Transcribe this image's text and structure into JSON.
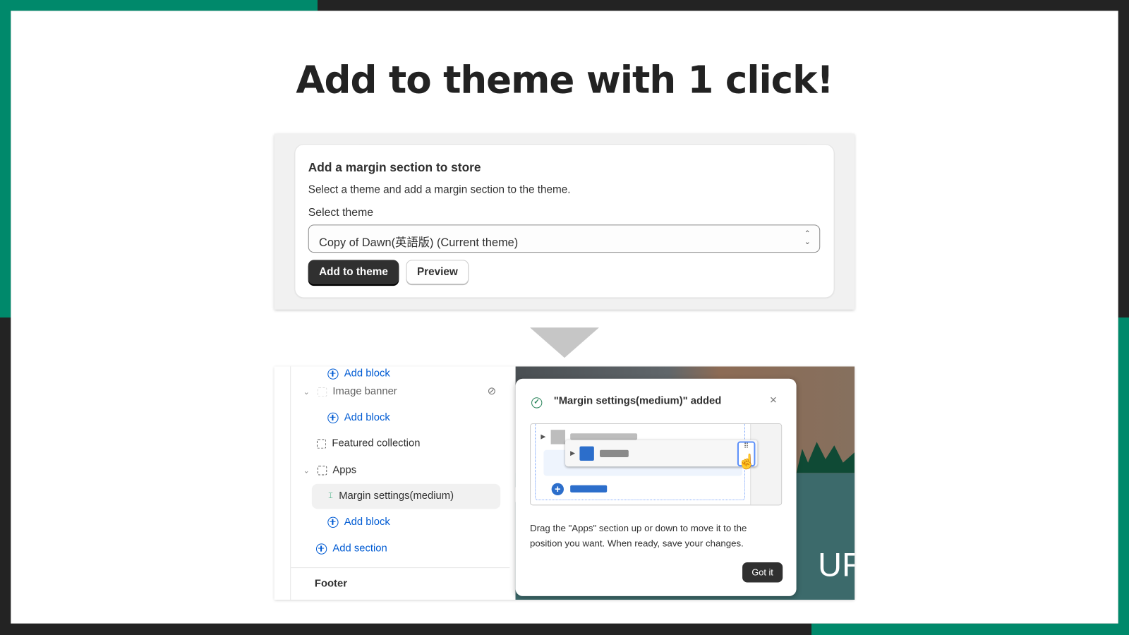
{
  "headline": "Add to theme with 1 click!",
  "card": {
    "title": "Add a margin section to store",
    "description": "Select a theme and add a margin section to the theme.",
    "select_label": "Select theme",
    "select_value": "Copy of Dawn(英語版) (Current theme)",
    "add_button": "Add to theme",
    "preview_button": "Preview"
  },
  "editor": {
    "items": [
      {
        "label": "Add block"
      },
      {
        "label": "Image banner"
      },
      {
        "label": "Add block"
      },
      {
        "label": "Featured collection"
      },
      {
        "label": "Apps"
      },
      {
        "label": "Margin settings(medium)"
      },
      {
        "label": "Add block"
      },
      {
        "label": "Add section"
      }
    ],
    "footer": "Footer"
  },
  "popover": {
    "title": "\"Margin settings(medium)\" added",
    "body": "Drag the \"Apps\" section up or down to move it to the position you want. When ready, save your changes.",
    "button": "Got it"
  },
  "preview_text": "UR",
  "colors": {
    "brand_green": "#00896b",
    "link_blue": "#005bd3",
    "dark": "#303030"
  }
}
